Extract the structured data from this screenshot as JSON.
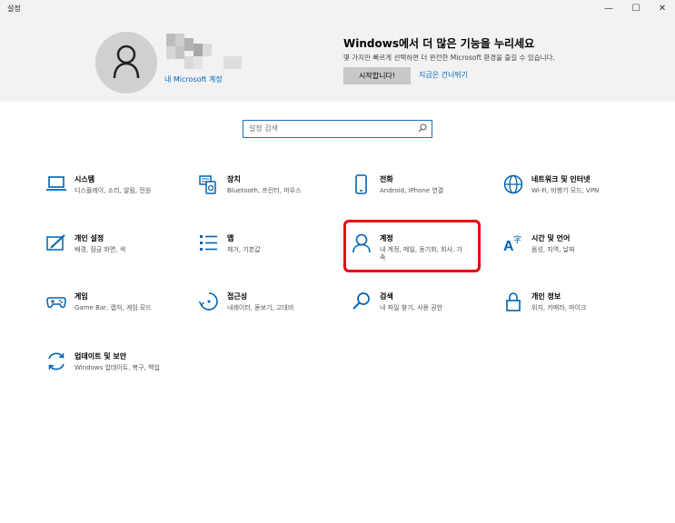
{
  "window": {
    "title": "설정",
    "minimize": "—",
    "maximize": "☐",
    "close": "✕"
  },
  "header": {
    "account_link": "내 Microsoft 계정",
    "promo_title": "Windows에서 더 많은 기능을 누리세요",
    "promo_desc": "몇 가지만 빠르게 선택하면 더 완전한 Microsoft 환경을 즐길 수 있습니다.",
    "start_button": "시작합니다!",
    "skip_link": "지금은 건너뛰기"
  },
  "search": {
    "placeholder": "설정 검색"
  },
  "colors": {
    "accent": "#0067c0",
    "icon": "#0063b1",
    "highlight": "#e60012"
  },
  "categories": [
    {
      "name": "시스템",
      "desc": "디스플레이, 소리, 알림, 전원",
      "icon": "laptop-icon"
    },
    {
      "name": "장치",
      "desc": "Bluetooth, 프린터, 마우스",
      "icon": "devices-icon"
    },
    {
      "name": "전화",
      "desc": "Android, iPhone 연결",
      "icon": "phone-icon"
    },
    {
      "name": "네트워크 및 인터넷",
      "desc": "Wi-Fi, 비행기 모드, VPN",
      "icon": "globe-icon"
    },
    {
      "name": "개인 설정",
      "desc": "배경, 잠금 화면, 색",
      "icon": "personalization-icon"
    },
    {
      "name": "앱",
      "desc": "제거, 기본값",
      "icon": "apps-icon"
    },
    {
      "name": "계정",
      "desc": "내 계정, 메일, 동기화, 회사, 가",
      "desc2": "족",
      "icon": "person-icon"
    },
    {
      "name": "시간 및 언어",
      "desc": "음성, 지역, 날짜",
      "icon": "language-icon"
    },
    {
      "name": "게임",
      "desc": "Game Bar, 캡처, 게임 모드",
      "icon": "gamepad-icon"
    },
    {
      "name": "접근성",
      "desc": "내레이터, 돋보기, 고대비",
      "icon": "accessibility-icon"
    },
    {
      "name": "검색",
      "desc": "내 파일 찾기, 사용 권한",
      "icon": "search-icon"
    },
    {
      "name": "개인 정보",
      "desc": "위치, 카메라, 마이크",
      "icon": "lock-icon"
    },
    {
      "name": "업데이트 및 보안",
      "desc": "Windows 업데이트, 복구, 백업",
      "icon": "update-icon"
    }
  ]
}
